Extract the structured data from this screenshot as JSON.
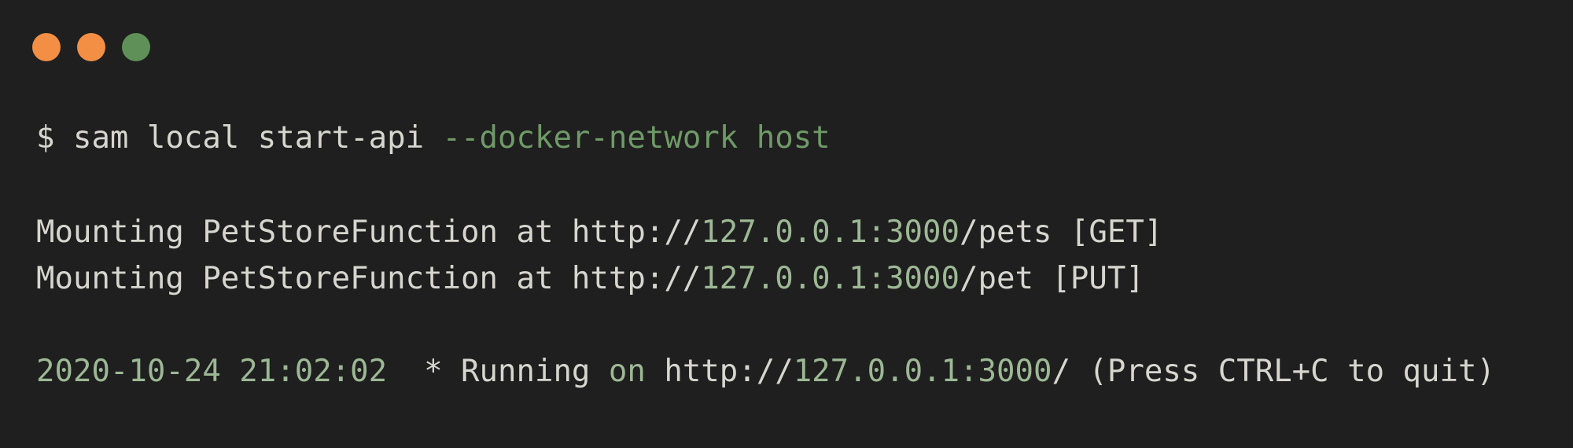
{
  "colors": {
    "background": "#1f1f1f",
    "text": "#d6d6cf",
    "accent": "#9cb894",
    "flag": "#6f9a67",
    "close_button": "#f28f45",
    "minimize_button": "#f28f45",
    "maximize_button": "#5f9057"
  },
  "window_controls": {
    "close_icon": "circle",
    "minimize_icon": "circle",
    "maximize_icon": "circle"
  },
  "command": {
    "prompt": "$ ",
    "text": "sam local start-api ",
    "flag": "--docker-network host"
  },
  "output": {
    "mount_lines": [
      {
        "prefix": "Mounting PetStoreFunction at http://",
        "address": "127.0.0.1:3000",
        "suffix": "/pets [GET]"
      },
      {
        "prefix": "Mounting PetStoreFunction at http://",
        "address": "127.0.0.1:3000",
        "suffix": "/pet [PUT]"
      }
    ],
    "running": {
      "timestamp": "2020-10-24 21:02:02",
      "middle": "  * Running ",
      "on": "on",
      "url_prefix": " http://",
      "address": "127.0.0.1:3000",
      "suffix": "/ (Press CTRL+C to quit)"
    }
  }
}
